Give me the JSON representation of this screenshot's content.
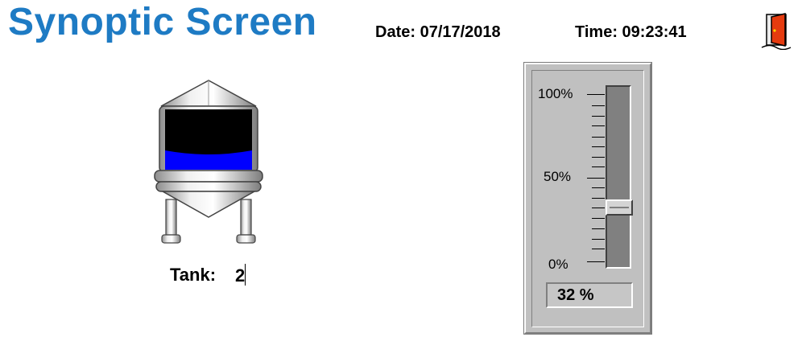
{
  "header": {
    "title": "Synoptic Screen",
    "date": "Date: 07/17/2018",
    "time": "Time: 09:23:41",
    "exit_icon": "exit-door-icon"
  },
  "tank": {
    "icon": "storage-tank-icon",
    "label": "Tank:",
    "input_value": "2",
    "liquid_color": "#0000ff",
    "level_fraction": 0.32
  },
  "level_panel": {
    "scale_labels": [
      "100%",
      "50%",
      "0%"
    ],
    "value": 32,
    "value_text": "32 %"
  },
  "colors": {
    "title": "#1e7bc4",
    "panel": "#c0c0c0"
  }
}
